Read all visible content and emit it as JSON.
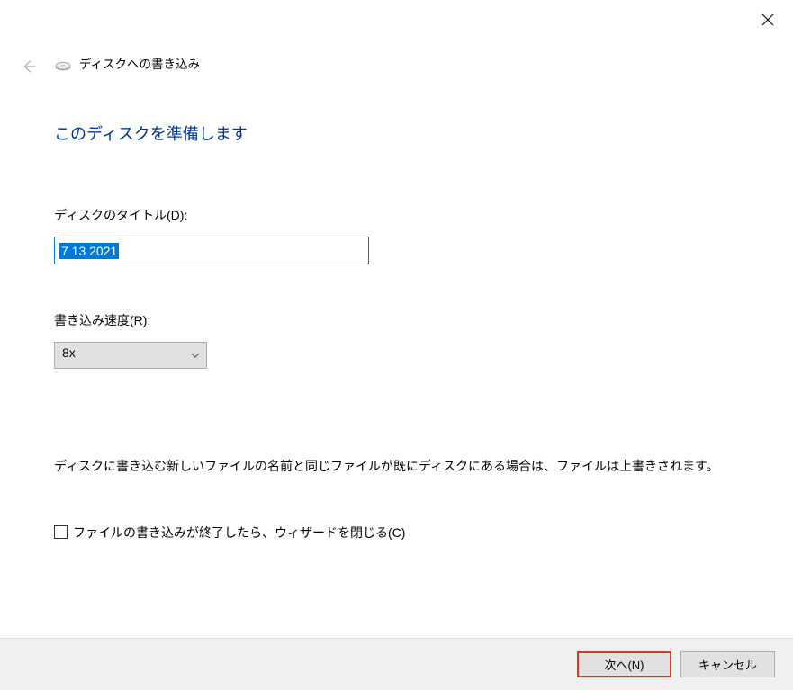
{
  "window": {
    "title": "ディスクへの書き込み"
  },
  "main": {
    "heading": "このディスクを準備します",
    "title_label": "ディスクのタイトル(D):",
    "title_value": "7 13 2021",
    "speed_label": "書き込み速度(R):",
    "speed_value": "8x",
    "description": "ディスクに書き込む新しいファイルの名前と同じファイルが既にディスクにある場合は、ファイルは上書きされます。",
    "checkbox_label": "ファイルの書き込みが終了したら、ウィザードを閉じる(C)"
  },
  "footer": {
    "next_label": "次へ(N)",
    "cancel_label": "キャンセル"
  },
  "icons": {
    "close": "close-icon",
    "back": "back-arrow-icon",
    "disc": "disc-icon",
    "chevron": "chevron-down-icon"
  }
}
